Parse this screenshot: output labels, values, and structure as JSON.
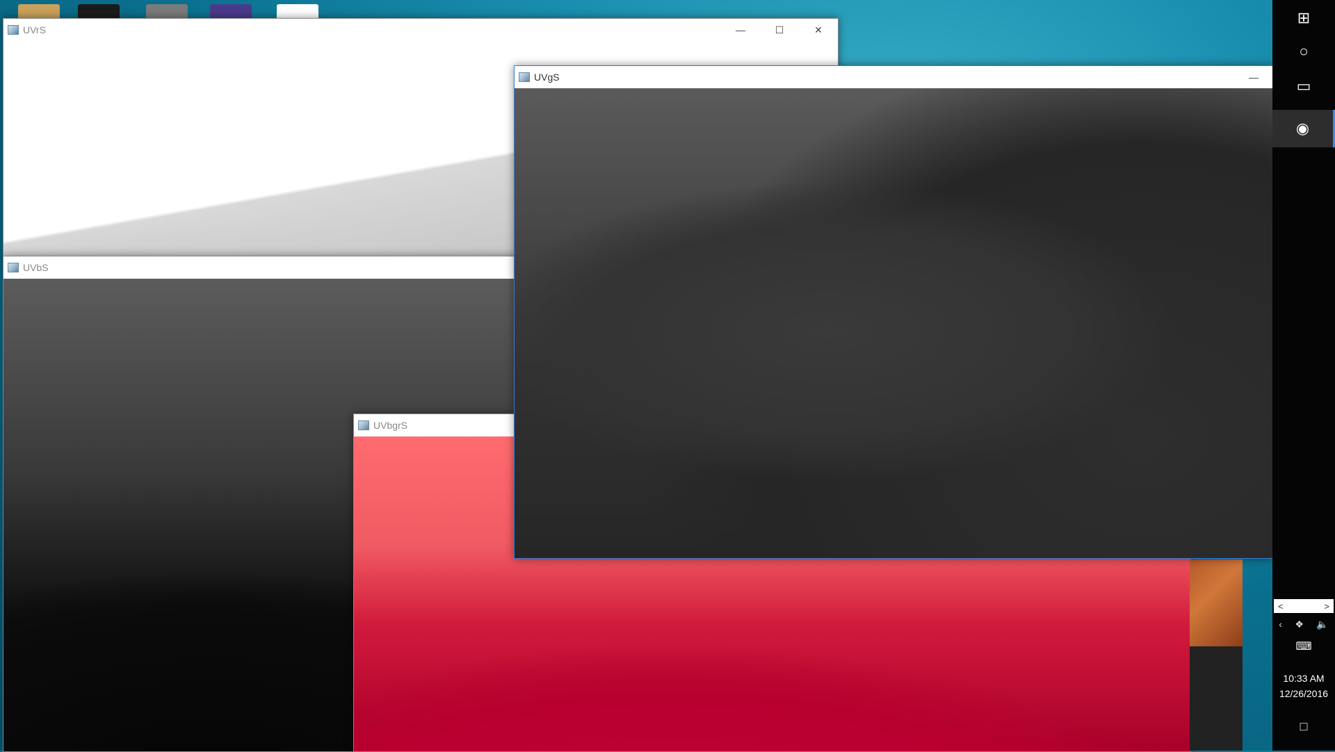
{
  "windows": {
    "uvrs": {
      "title": "UVrS"
    },
    "uvbs": {
      "title": "UVbS"
    },
    "uvbgrs": {
      "title": "UVbgrS"
    },
    "uvgs": {
      "title": "UVgS"
    }
  },
  "taskbar": {
    "time": "10:33 AM",
    "date": "12/26/2016",
    "icons": [
      "windows-logo-icon",
      "cortana-icon",
      "task-view-icon",
      "python-icon"
    ]
  },
  "colors": {
    "active_border": "#3a7bd5",
    "taskbar_bg": "#050505",
    "uvbgrs_red": "#c4003a"
  }
}
